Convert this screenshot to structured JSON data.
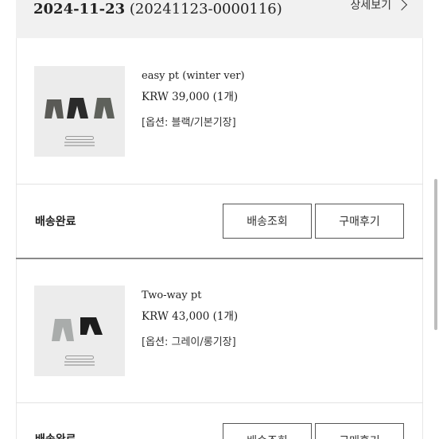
{
  "order": {
    "date": "2024-11-23",
    "number": "(20241123-0000116)",
    "detail_label": "상세보기"
  },
  "items": [
    {
      "name": "easy pt (winter ver)",
      "price": "KRW 39,000 (1개)",
      "option": "[옵션: 블랙/기본기장]",
      "pants_colors": [
        "#5a5a56",
        "#2a2a2a",
        "#5e615b"
      ],
      "status": "배송완료",
      "track_label": "배송조회",
      "review_label": "구매후기"
    },
    {
      "name": "Two-way pt",
      "price": "KRW 43,000 (1개)",
      "option": "[옵션: 그레이/롱기장]",
      "pants_colors": [
        "#a9acab",
        "#1d1d1d"
      ],
      "status": "배송완료",
      "track_label": "배송조회",
      "review_label": "구매후기"
    }
  ]
}
